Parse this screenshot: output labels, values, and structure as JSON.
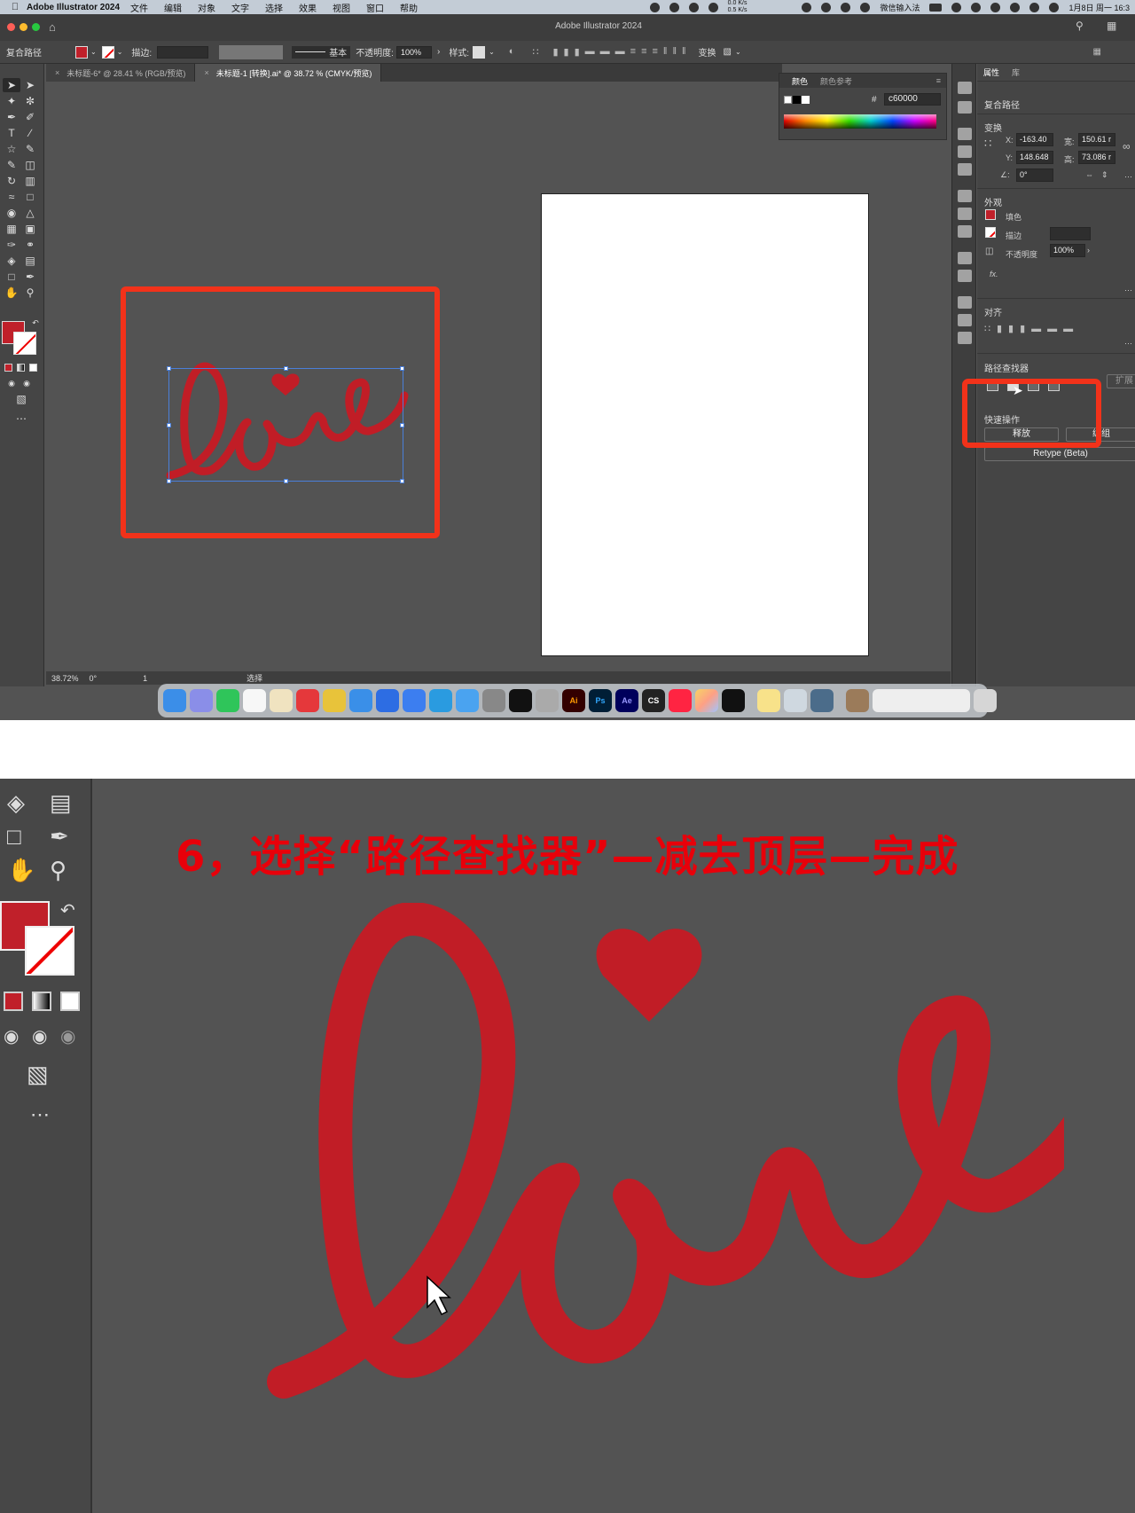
{
  "menubar": {
    "app_name": "Adobe Illustrator 2024",
    "items": [
      "文件",
      "编辑",
      "对象",
      "文字",
      "选择",
      "效果",
      "视图",
      "窗口",
      "帮助"
    ],
    "net_up": "0.0 K/s",
    "net_down": "0.5 K/s",
    "ime": "微信输入法",
    "datetime": "1月8日 周一 16:3"
  },
  "window": {
    "title": "Adobe Illustrator 2024"
  },
  "controlbar": {
    "object_type": "复合路径",
    "stroke_label": "描边:",
    "stroke_style": "基本",
    "opacity_label": "不透明度:",
    "opacity_value": "100%",
    "style_label": "样式:",
    "transform_label": "变换"
  },
  "tabs": [
    {
      "label": "未标题-6* @ 28.41 % (RGB/预览)"
    },
    {
      "label": "未标题-1 [转换].ai* @ 38.72 % (CMYK/预览)"
    }
  ],
  "color_panel": {
    "tab_color": "颜色",
    "tab_guide": "颜色参考",
    "hash": "#",
    "hex_value": "c60000"
  },
  "properties": {
    "tab_props": "属性",
    "tab_lib": "库",
    "object_type": "复合路径",
    "transform_title": "变换",
    "x_label": "X:",
    "x_value": "-163.40",
    "y_label": "Y:",
    "y_value": "148.648",
    "w_label": "宽:",
    "w_value": "150.61 r",
    "h_label": "高:",
    "h_value": "73.086 r",
    "angle_label": "∠:",
    "angle_value": "0°",
    "appearance_title": "外观",
    "fill_label": "填色",
    "stroke_label": "描边",
    "opacity_label": "不透明度",
    "opacity_value": "100%",
    "fx_label": "fx.",
    "align_title": "对齐",
    "pathfinder_title": "路径查找器",
    "expand_label": "扩展",
    "quick_actions_title": "快速操作",
    "release_button": "释放",
    "group_button": "编组",
    "retype_button": "Retype (Beta)"
  },
  "statusbar": {
    "zoom": "38.72%",
    "rotation": "0°",
    "page": "1",
    "mode": "选择"
  },
  "canvas": {
    "art_text": "love"
  },
  "dock": {
    "apps": [
      "Finder",
      "Launchpad",
      "微信",
      "QQ",
      "m",
      "WPS",
      "Chrome",
      "Safari",
      "zoom",
      "飞书",
      "Edge",
      "文件",
      "设置",
      "剪映",
      "Blender",
      "Ai",
      "Ps",
      "Ae",
      "CS",
      "小红书",
      "颜色",
      "抖音",
      "备忘录",
      "预览",
      "QuickTime",
      "文件夹",
      "废纸篓"
    ]
  },
  "zoomed_view": {
    "caption": "6，选择“路径查找器”—减去顶层—完成",
    "art_text": "love"
  },
  "colors": {
    "accent_red": "#c11d26",
    "highlight_box": "#f2321a",
    "caption_red": "#e8000a",
    "app_bg": "#535353",
    "panel_bg": "#454545"
  }
}
